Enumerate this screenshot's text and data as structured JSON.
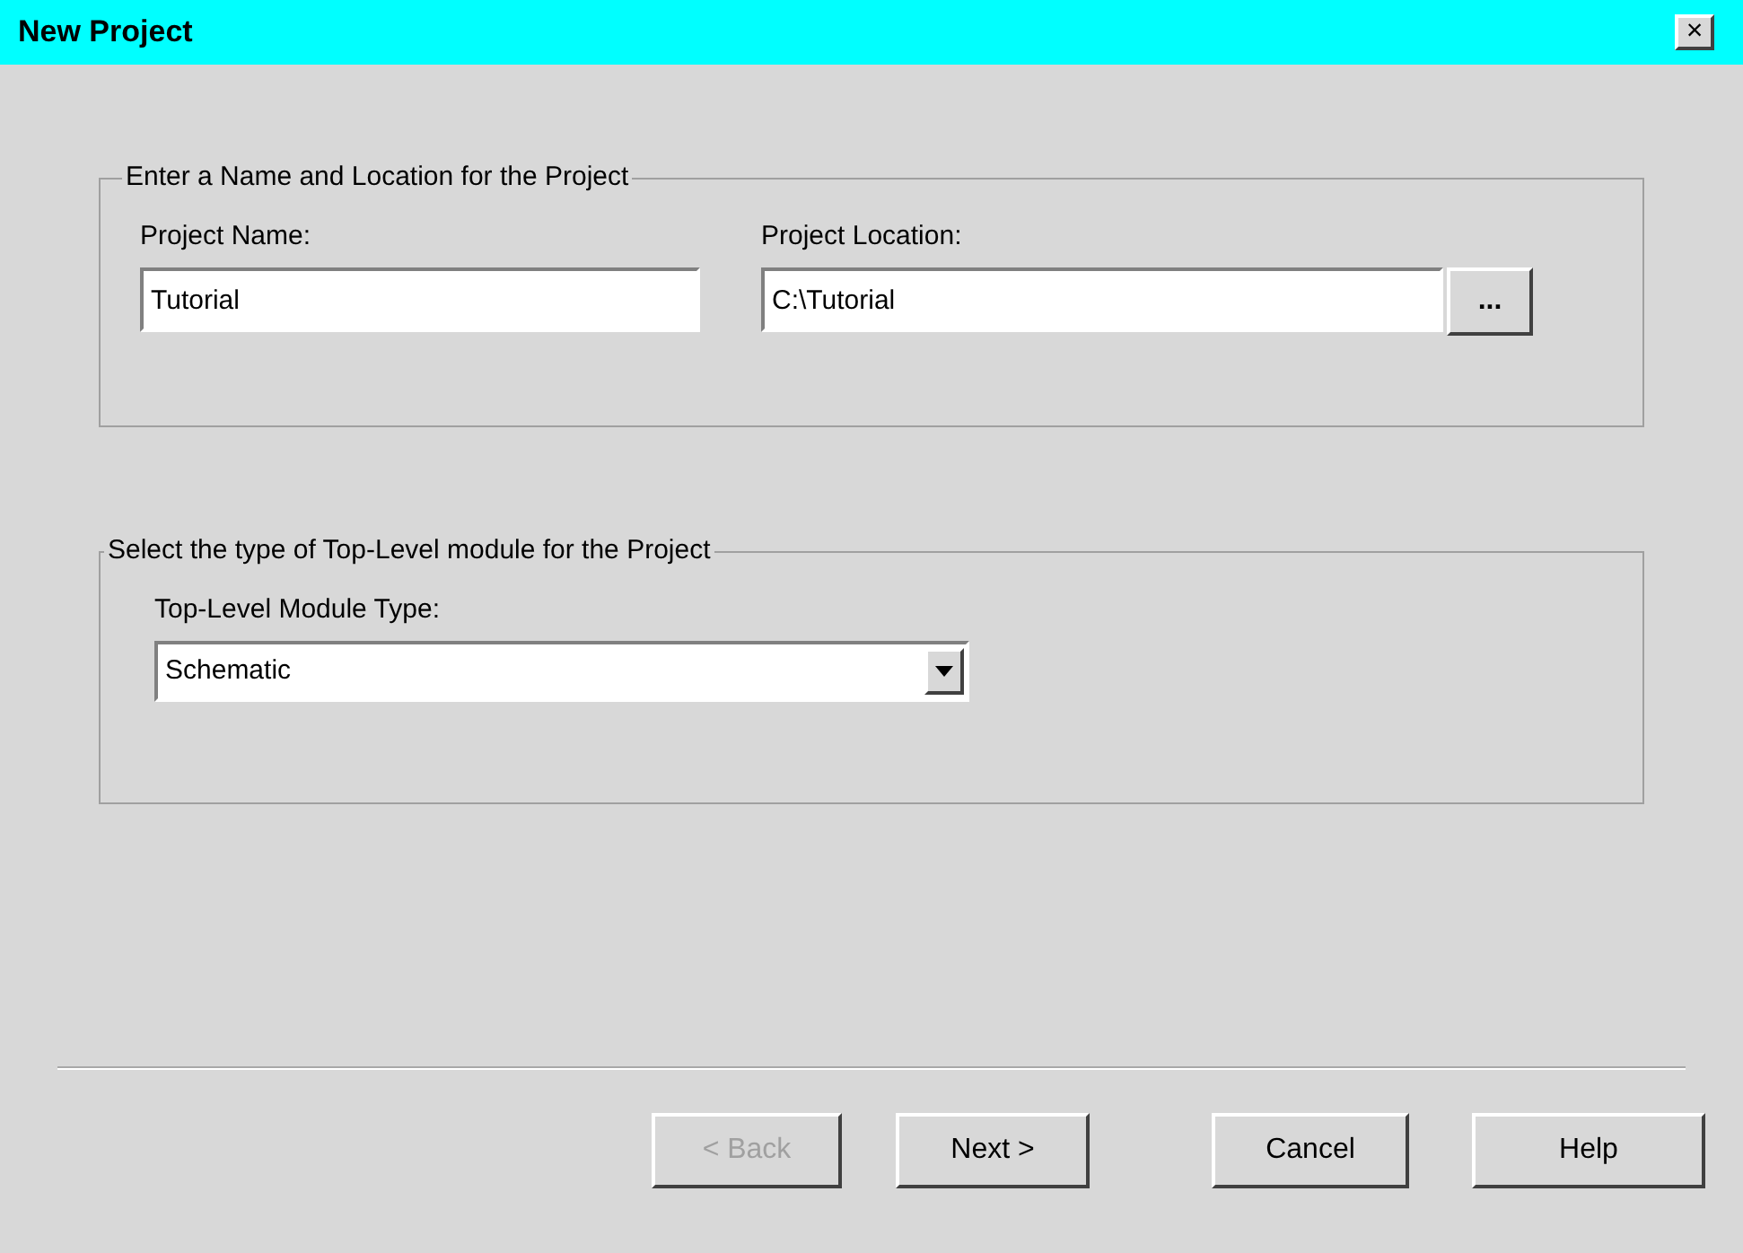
{
  "window": {
    "title": "New Project",
    "close": "×"
  },
  "group_name_location": {
    "legend": "Enter a Name and Location for the Project",
    "project_name": {
      "label": "Project Name:",
      "value": "Tutorial"
    },
    "project_location": {
      "label": "Project Location:",
      "value": "C:\\Tutorial"
    },
    "browse_button": "..."
  },
  "group_module": {
    "legend": "Select the type of Top-Level module for the Project",
    "module_type": {
      "label": "Top-Level Module Type:",
      "value": "Schematic"
    }
  },
  "buttons": [
    {
      "label": "< Back",
      "disabled": true
    },
    {
      "label": "Next >",
      "disabled": false
    },
    {
      "label": "Cancel",
      "disabled": false
    },
    {
      "label": "Help",
      "disabled": false
    }
  ]
}
